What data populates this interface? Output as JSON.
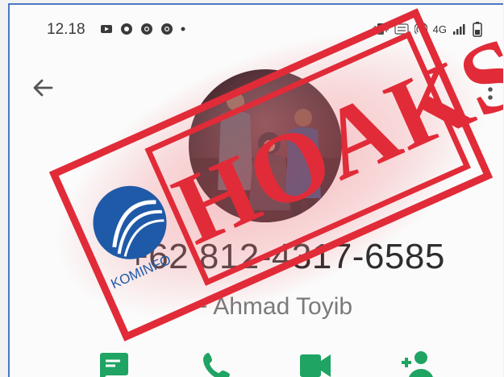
{
  "statusbar": {
    "time": "12.18",
    "network_label": "4G"
  },
  "contact": {
    "phone_number": "+62 812-4317-6585",
    "name": "~ Ahmad Toyib"
  },
  "stamp": {
    "text": "HOAKS",
    "logo_text": "KOMINFO"
  },
  "icons": {
    "back": "arrow-left-icon",
    "more": "more-vert-icon",
    "message": "message-icon",
    "call": "phone-icon",
    "video": "video-icon",
    "add_contact": "add-person-icon"
  },
  "colors": {
    "accent_green": "#1fa463",
    "stamp_red": "#e12b38",
    "kominfo_blue": "#1f5aa8"
  }
}
